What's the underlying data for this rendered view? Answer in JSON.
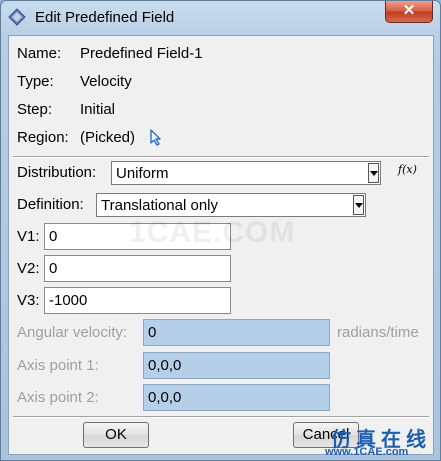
{
  "window": {
    "title": "Edit Predefined Field",
    "close_glyph": "✕"
  },
  "info": {
    "name_label": "Name:",
    "name_value": "Predefined Field-1",
    "type_label": "Type:",
    "type_value": "Velocity",
    "step_label": "Step:",
    "step_value": "Initial",
    "region_label": "Region:",
    "region_value": "(Picked)",
    "region_icon": "cursor-arrow-icon"
  },
  "distribution": {
    "label": "Distribution:",
    "value": "Uniform",
    "fx_label": "f(x)"
  },
  "definition": {
    "label": "Definition:",
    "value": "Translational only"
  },
  "velocity": [
    {
      "label": "V1:",
      "value": "0"
    },
    {
      "label": "V2:",
      "value": "0"
    },
    {
      "label": "V3:",
      "value": "-1000"
    }
  ],
  "angular": {
    "label": "Angular velocity:",
    "value": "0",
    "units": "radians/time",
    "axis1_label": "Axis point 1:",
    "axis1_value": "0,0,0",
    "axis2_label": "Axis point 2:",
    "axis2_value": "0,0,0"
  },
  "buttons": {
    "ok": "OK",
    "cancel": "Cancel"
  },
  "watermark": {
    "text": "1CAE.COM",
    "brand_cn": "仿真在线",
    "brand_url": "www.1CAE.com"
  },
  "colors": {
    "disabled_field": "#b6cfe8",
    "brand": "#1d5fae",
    "close": "#c23a1f"
  }
}
